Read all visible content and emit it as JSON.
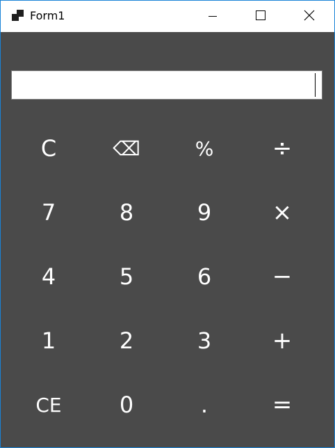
{
  "window": {
    "title": "Form1",
    "icon": "app-icon",
    "controls": {
      "minimize": "minimize-icon",
      "maximize": "maximize-icon",
      "close": "close-icon"
    },
    "background": "#4a4a4a"
  },
  "display": {
    "value": ""
  },
  "keys": {
    "clear": "C",
    "backspace": "⌫",
    "percent": "%",
    "divide": "÷",
    "seven": "7",
    "eight": "8",
    "nine": "9",
    "multiply": "×",
    "four": "4",
    "five": "5",
    "six": "6",
    "subtract": "−",
    "one": "1",
    "two": "2",
    "three": "3",
    "add": "+",
    "clear_entry": "CE",
    "zero": "0",
    "decimal": ".",
    "equals": "="
  }
}
